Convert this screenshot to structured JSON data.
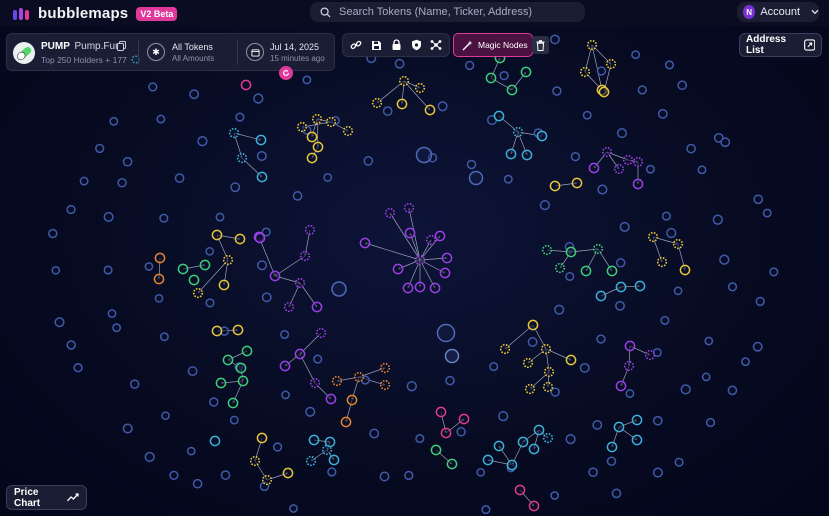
{
  "header": {
    "brand_name": "bubblemaps",
    "beta_badge": "V2 Beta",
    "search_placeholder": "Search Tokens (Name, Ticker, Address)",
    "account_initial": "N",
    "account_label": "Account"
  },
  "token_card": {
    "ticker": "PUMP",
    "platform": "Pump.Fun",
    "holders_summary": "Top 250 Holders + 177",
    "tokens_filter": "All Tokens",
    "amounts_filter": "All Amounts",
    "date": "Jul 14, 2025",
    "updated": "15 minutes ago"
  },
  "toolbar": {
    "tools": [
      "link-icon",
      "save-icon",
      "lock-icon",
      "shield-icon",
      "share-icon"
    ],
    "magic_nodes_label": "Magic Nodes",
    "delete_icon": "trash-icon"
  },
  "address_list_label": "Address List",
  "price_chart_label": "Price Chart",
  "colors": {
    "accent": "#e0399b",
    "yellow": "#e8c73a",
    "purple": "#9b3fe6",
    "blue": "#3cb1d8",
    "green": "#3ccf7a",
    "orange": "#e9822e",
    "pink": "#e23a8e",
    "neutral": "#3f5aa8"
  }
}
